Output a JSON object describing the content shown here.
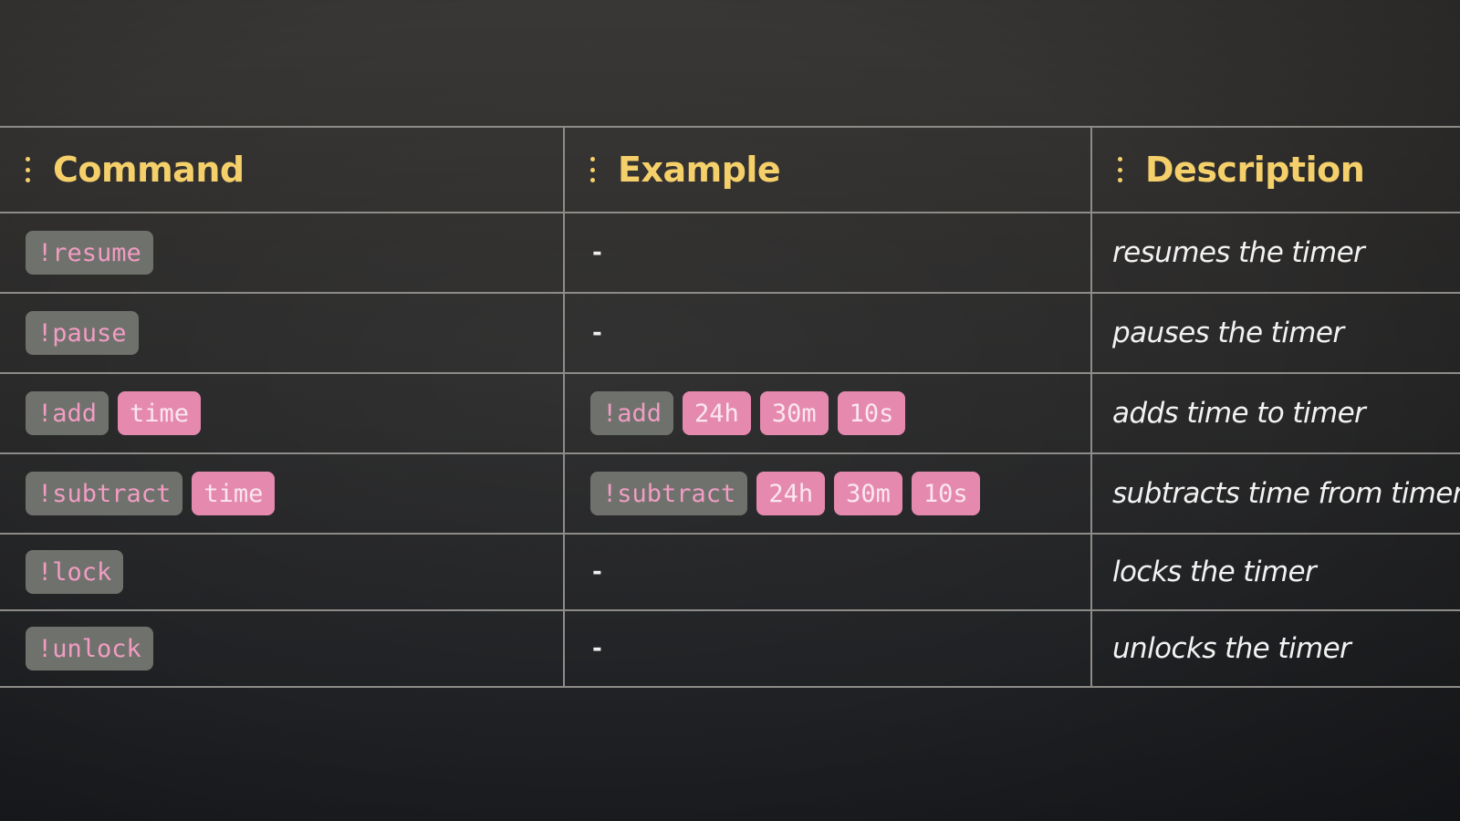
{
  "table": {
    "headers": {
      "command": "Command",
      "example": "Example",
      "description": "Description"
    },
    "rows": [
      {
        "command": "!resume",
        "command_args": [],
        "example": "-",
        "example_args": [],
        "description": "resumes the timer"
      },
      {
        "command": "!pause",
        "command_args": [],
        "example": "-",
        "example_args": [],
        "description": "pauses the timer"
      },
      {
        "command": "!add",
        "command_args": [
          "time"
        ],
        "example": "!add",
        "example_args": [
          "24h",
          "30m",
          "10s"
        ],
        "description": "adds time to timer"
      },
      {
        "command": "!subtract",
        "command_args": [
          "time"
        ],
        "example": "!subtract",
        "example_args": [
          "24h",
          "30m",
          "10s"
        ],
        "description": "subtracts time from timer"
      },
      {
        "command": "!lock",
        "command_args": [],
        "example": "-",
        "example_args": [],
        "description": "locks the timer"
      },
      {
        "command": "!unlock",
        "command_args": [],
        "example": "-",
        "example_args": [],
        "description": "unlocks the timer"
      }
    ]
  },
  "colors": {
    "header_text": "#f5d06a",
    "command_chip_bg": "#6f726c",
    "command_chip_text": "#f29cc4",
    "arg_chip_bg": "#e58aae",
    "arg_chip_text": "#fbe7ef",
    "grid_line": "#8e8c88"
  },
  "icons": {
    "column_handle": "drag-handle-icon"
  }
}
